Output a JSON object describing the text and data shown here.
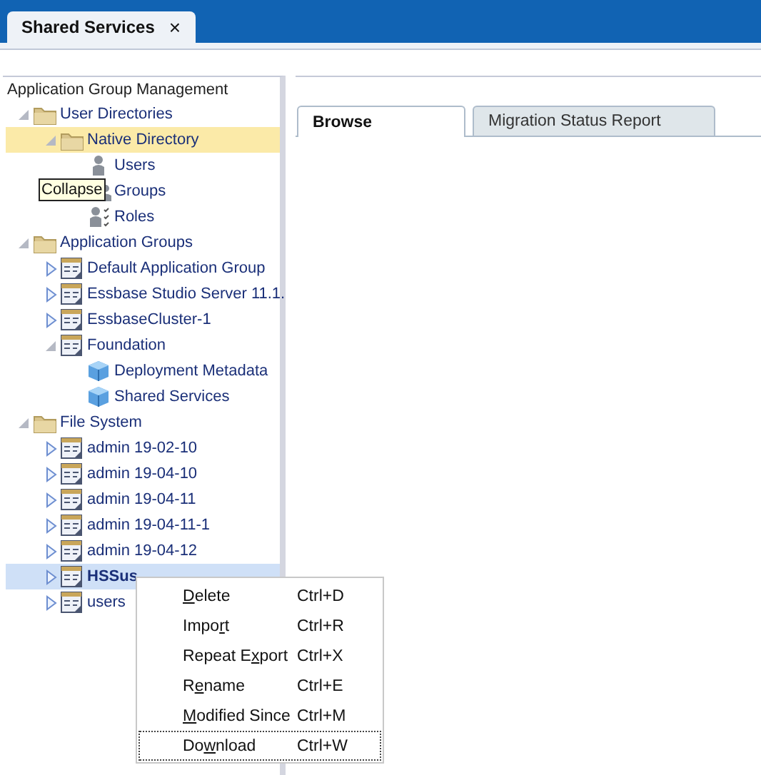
{
  "window_tab": {
    "title": "Shared Services",
    "close": "×"
  },
  "left_panel": {
    "title": "Application Group Management",
    "tree": [
      {
        "label": "User Directories",
        "kind": "folder",
        "expanded": true,
        "selected": false,
        "hovered": false,
        "children": [
          {
            "label": "Native Directory",
            "kind": "folder",
            "expanded": true,
            "selected": false,
            "hovered": true,
            "children": [
              {
                "label": "Users",
                "kind": "user",
                "selected": false,
                "hovered": false
              },
              {
                "label": "Groups",
                "kind": "group",
                "selected": false,
                "hovered": false
              },
              {
                "label": "Roles",
                "kind": "role",
                "selected": false,
                "hovered": false
              }
            ]
          }
        ]
      },
      {
        "label": "Application Groups",
        "kind": "folder",
        "expanded": true,
        "selected": false,
        "hovered": false,
        "children": [
          {
            "label": "Default Application Group",
            "kind": "app",
            "expanded": false,
            "selected": false,
            "hovered": false
          },
          {
            "label": "Essbase Studio Server 11.1.",
            "kind": "app",
            "expanded": false,
            "selected": false,
            "hovered": false
          },
          {
            "label": "EssbaseCluster-1",
            "kind": "app",
            "expanded": false,
            "selected": false,
            "hovered": false
          },
          {
            "label": "Foundation",
            "kind": "app",
            "expanded": true,
            "selected": false,
            "hovered": false,
            "children": [
              {
                "label": "Deployment Metadata",
                "kind": "cube",
                "selected": false,
                "hovered": false
              },
              {
                "label": "Shared Services",
                "kind": "cube",
                "selected": false,
                "hovered": false
              }
            ]
          }
        ]
      },
      {
        "label": "File System",
        "kind": "folder",
        "expanded": true,
        "selected": false,
        "hovered": false,
        "children": [
          {
            "label": "admin 19-02-10",
            "kind": "app",
            "expanded": false,
            "selected": false,
            "hovered": false
          },
          {
            "label": "admin 19-04-10",
            "kind": "app",
            "expanded": false,
            "selected": false,
            "hovered": false
          },
          {
            "label": "admin 19-04-11",
            "kind": "app",
            "expanded": false,
            "selected": false,
            "hovered": false
          },
          {
            "label": "admin 19-04-11-1",
            "kind": "app",
            "expanded": false,
            "selected": false,
            "hovered": false
          },
          {
            "label": "admin 19-04-12",
            "kind": "app",
            "expanded": false,
            "selected": false,
            "hovered": false
          },
          {
            "label": "HSSus",
            "kind": "app",
            "expanded": false,
            "selected": true,
            "hovered": false
          },
          {
            "label": "users",
            "kind": "app",
            "expanded": false,
            "selected": false,
            "hovered": false
          }
        ]
      }
    ]
  },
  "tooltip": "Collapse",
  "right_panel": {
    "tabs": [
      {
        "label": "Browse",
        "selected": true
      },
      {
        "label": "Migration Status Report",
        "selected": false
      }
    ]
  },
  "context_menu": [
    {
      "label": {
        "mnemonic": "D",
        "after": "elete"
      },
      "shortcut": "Ctrl+D",
      "focused": false
    },
    {
      "label": {
        "before": "Impo",
        "mnemonic": "r",
        "after": "t"
      },
      "shortcut": "Ctrl+R",
      "focused": false
    },
    {
      "label": {
        "before": "Repeat E",
        "mnemonic": "x",
        "after": "port"
      },
      "shortcut": "Ctrl+X",
      "focused": false
    },
    {
      "label": {
        "before": "R",
        "mnemonic": "e",
        "after": "name"
      },
      "shortcut": "Ctrl+E",
      "focused": false
    },
    {
      "label": {
        "mnemonic": "M",
        "after": "odified Since"
      },
      "shortcut": "Ctrl+M",
      "focused": false
    },
    {
      "label": {
        "before": "Do",
        "mnemonic": "w",
        "after": "nload"
      },
      "shortcut": "Ctrl+W",
      "focused": true
    }
  ]
}
